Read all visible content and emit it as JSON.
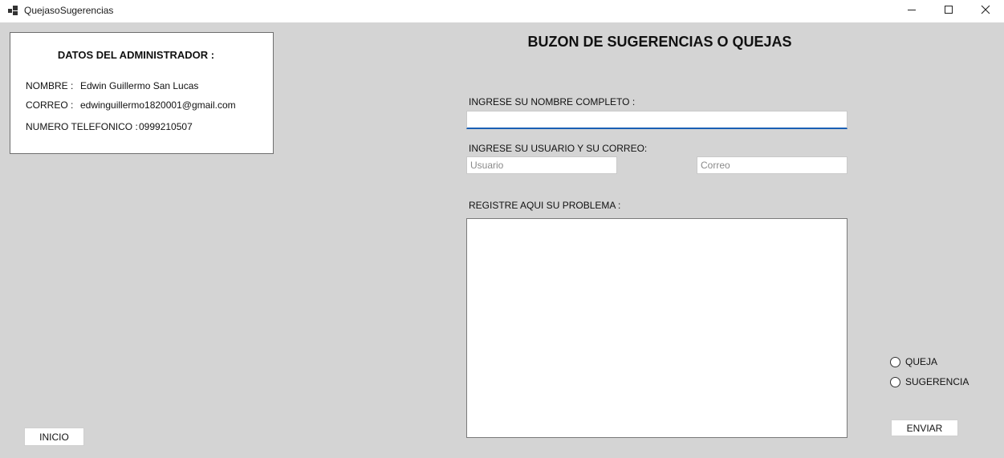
{
  "window": {
    "title": "QuejasoSugerencias",
    "icon": "app-window-icon",
    "controls": {
      "minimize_icon": "minimize-icon",
      "maximize_icon": "maximize-icon",
      "close_icon": "close-icon"
    }
  },
  "admin": {
    "title": "DATOS DEL ADMINISTRADOR :",
    "name_label": "NOMBRE :",
    "name_value": "Edwin Guillermo San Lucas",
    "email_label": "CORREO :",
    "email_value": "edwinguillermo1820001@gmail.com",
    "phone_label": "NUMERO TELEFONICO :",
    "phone_value": "0999210507"
  },
  "form": {
    "title": "BUZON DE SUGERENCIAS O QUEJAS",
    "name_label": "INGRESE SU NOMBRE COMPLETO :",
    "name_value": "",
    "user_email_label": "INGRESE SU USUARIO Y SU CORREO:",
    "user_placeholder": "Usuario",
    "email_placeholder": "Correo",
    "problem_label": "REGISTRE AQUI SU PROBLEMA :",
    "problem_value": ""
  },
  "options": {
    "queja_label": "QUEJA",
    "sugerencia_label": "SUGERENCIA",
    "selected": null
  },
  "buttons": {
    "send_label": "ENVIAR",
    "home_label": "INICIO"
  },
  "colors": {
    "background": "#d4d4d4",
    "focus_accent": "#1a5fb4",
    "panel": "#ffffff"
  }
}
